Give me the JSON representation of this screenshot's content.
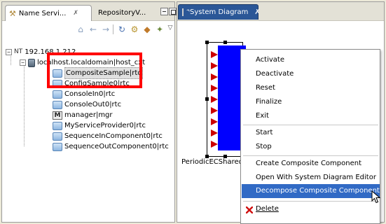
{
  "left_view": {
    "tabs": [
      {
        "label": "Name Servi...",
        "close": "✗"
      },
      {
        "label": "RepositoryV..."
      }
    ],
    "tree": {
      "root_label": "192.168.1.212",
      "host_label": "localhost.localdomain|host_cxt",
      "items": [
        "CompositeSample|rtc",
        "ConfigSample0|rtc",
        "ConsoleIn0|rtc",
        "ConsoleOut0|rtc",
        "manager|mgr",
        "MyServiceProvider0|rtc",
        "SequenceInComponent0|rtc",
        "SequenceOutComponent0|rtc"
      ]
    }
  },
  "editor": {
    "tab_label": "*System Diagram",
    "tab_close": "✗",
    "component_label": "PeriodicECShared"
  },
  "context_menu": {
    "items": [
      {
        "label": "Activate"
      },
      {
        "label": "Deactivate"
      },
      {
        "label": "Reset"
      },
      {
        "label": "Finalize"
      },
      {
        "label": "Exit"
      },
      {
        "label": "Start"
      },
      {
        "label": "Stop"
      },
      {
        "label": "Create Composite Component"
      },
      {
        "label": "Open With System Diagram Editor"
      },
      {
        "label": "Decompose Composite Component"
      },
      {
        "label": "Delete"
      }
    ],
    "highlighted": "Decompose Composite Component"
  },
  "colors": {
    "highlight_box": "#ff0000",
    "component_fill": "#0000ff",
    "menu_highlight": "#316ac5",
    "port_color": "#cc0000"
  },
  "icons": [
    "view-icon",
    "home-icon",
    "back-icon",
    "forward-icon",
    "refresh-icon",
    "filter-icon",
    "collapse-icon",
    "link-icon",
    "view-menu-icon",
    "minimize-icon",
    "maximize-icon",
    "diagram-icon",
    "delete-icon",
    "cursor-icon"
  ]
}
